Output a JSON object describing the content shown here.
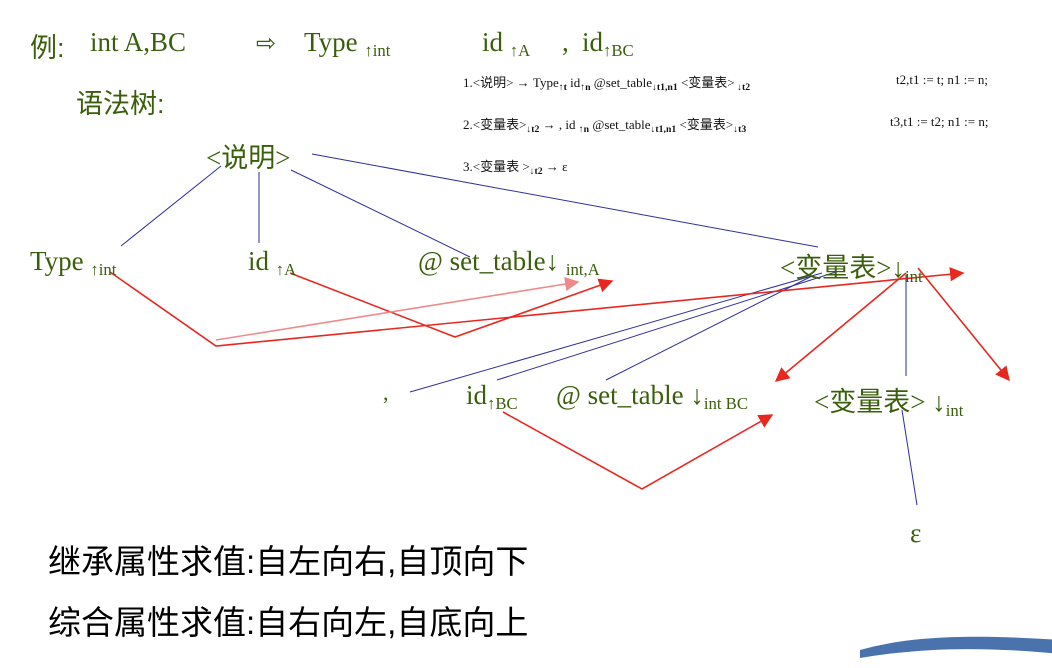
{
  "header": {
    "example_label": "例:",
    "input": "int A,BC",
    "arrow": "⇨",
    "type": "Type",
    "type_sub": "↑int",
    "idA": "id",
    "idA_sub": "↑A",
    "comma": ",",
    "idBC": "id",
    "idBC_sub": "↑BC",
    "tree_label": "语法树:"
  },
  "rules": [
    {
      "num": "1.",
      "lhs": "<说明>",
      "arrow": " → ",
      "body": [
        [
          "Type",
          ""
        ],
        [
          "↑t",
          "s"
        ],
        [
          "  id",
          ""
        ],
        [
          "↑n",
          "s"
        ],
        [
          " @set_table",
          ""
        ],
        [
          "↓t1,n1",
          "s"
        ],
        [
          " <变量表>",
          ""
        ],
        [
          " ↓t2",
          "s"
        ]
      ],
      "action": "t2,t1 := t;   n1 := n;"
    },
    {
      "num": "2.",
      "lhs": "<变量表>",
      "lhs_sub": "↓t2",
      "arrow": " → ",
      "body": [
        [
          ",  id ",
          ""
        ],
        [
          "↑n",
          "s"
        ],
        [
          " @set_table",
          ""
        ],
        [
          "↓t1,n1",
          "s"
        ],
        [
          " <变量表>",
          ""
        ],
        [
          "↓t3",
          "s"
        ]
      ],
      "action": "t3,t1 := t2;    n1 := n;"
    },
    {
      "num": "3.",
      "lhs": "<变量表 >",
      "lhs_sub": "↓t2",
      "arrow": " → ",
      "body": [
        [
          "ε",
          ""
        ]
      ],
      "action": ""
    }
  ],
  "tree": {
    "root": "<说明>",
    "type_node": "Type",
    "type_sub": "↑int",
    "idA": "id",
    "idA_sub": "↑A",
    "set1": "@ set_table↓",
    "set1_sub": "int,A",
    "var1": "<变量表>↓",
    "var1_sub": "int",
    "comma": ",",
    "idBC": "id",
    "idBC_sub": "↑BC",
    "set2": "@ set_table ↓",
    "set2_sub": "int BC",
    "var2": "<变量表> ↓",
    "var2_sub": "int",
    "epsilon": "ε"
  },
  "footer": {
    "inherited": "继承属性求值:自左向右,自顶向下",
    "synthesized": "综合属性求值:自右向左,自底向上"
  },
  "colors": {
    "text": "#3a5f0b",
    "tree_edge": "#2e2e9e",
    "flow_edge": "#e8281e"
  }
}
